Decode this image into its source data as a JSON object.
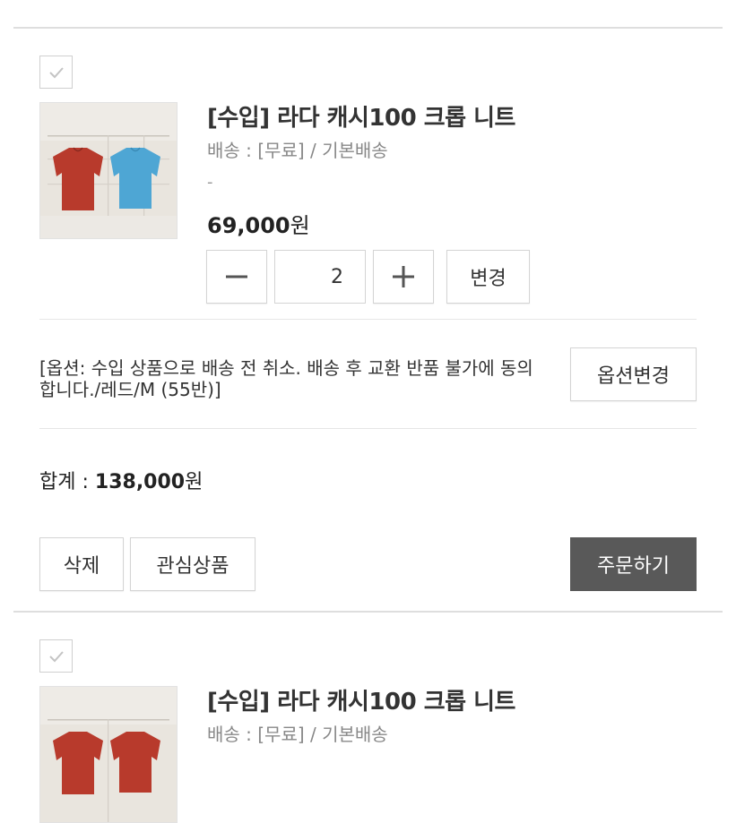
{
  "items": [
    {
      "title": "[수입] 라다 캐시100 크롭 니트",
      "shipping": "배송 : [무료] / 기본배송",
      "option_dash": "-",
      "price_value": "69,000",
      "price_unit": "원",
      "quantity": "2",
      "change_label": "변경",
      "option_text": "[옵션: 수입 상품으로 배송 전 취소. 배송 후 교환 반품 불가에 동의합니다./레드/M (55반)]",
      "option_change_label": "옵션변경",
      "total_label": "합계 : ",
      "total_value": "138,000",
      "total_unit": "원",
      "delete_label": "삭제",
      "wishlist_label": "관심상품",
      "order_label": "주문하기"
    },
    {
      "title": "[수입] 라다 캐시100 크롭 니트",
      "shipping": "배송 : [무료] / 기본배송"
    }
  ],
  "icons": {
    "checkbox": "check-icon",
    "minus": "minus-icon",
    "plus": "plus-icon"
  },
  "colors": {
    "order_button_bg": "#595959",
    "shirt_red": "#b83a2c",
    "shirt_blue": "#4ea6d4"
  }
}
